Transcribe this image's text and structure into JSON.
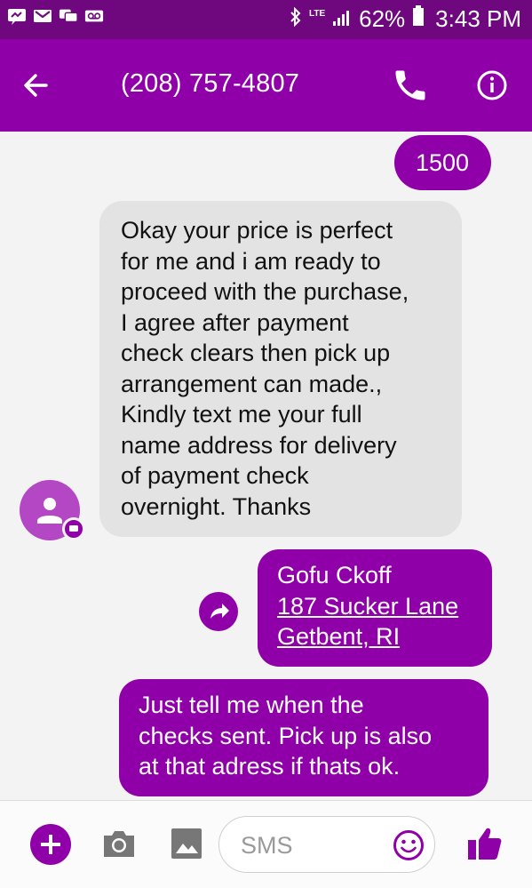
{
  "status_bar": {
    "left_icons": [
      "messenger-notification-icon",
      "gmail-icon",
      "chat-notification-icon",
      "voicemail-icon"
    ],
    "network": "LTE",
    "battery": "62%",
    "time": "3:43 PM"
  },
  "header": {
    "title": "(208) 757-4807",
    "icons": [
      "back-arrow-icon",
      "phone-icon",
      "info-icon"
    ]
  },
  "messages": [
    {
      "direction": "outgoing",
      "lines": [
        "1500"
      ]
    },
    {
      "direction": "incoming",
      "lines": [
        "Okay your price is perfect",
        "for me and i am ready to",
        "proceed with the purchase,",
        "I agree after payment",
        "check clears then pick up",
        "arrangement can made.,",
        "Kindly text me your full",
        "name address for delivery",
        "of payment check",
        "overnight. Thanks"
      ]
    },
    {
      "direction": "outgoing",
      "lines": [
        "Gofu Ckoff",
        "187 Sucker Lane",
        "Getbent, RI"
      ]
    },
    {
      "direction": "outgoing",
      "lines": [
        "Just tell me when the",
        "checks sent. Pick up is also",
        "at that adress if thats ok."
      ]
    }
  ],
  "compose": {
    "placeholder": "SMS",
    "icons": [
      "add-icon",
      "camera-icon",
      "gallery-icon",
      "emoji-icon",
      "thumbs-up-icon"
    ]
  },
  "colors": {
    "status_bar": "#6f087f",
    "toolbar": "#8f00a8",
    "outgoing_bubble": "#8f00a8",
    "incoming_bubble": "#e3e3e3",
    "background": "#f3f3f3"
  }
}
